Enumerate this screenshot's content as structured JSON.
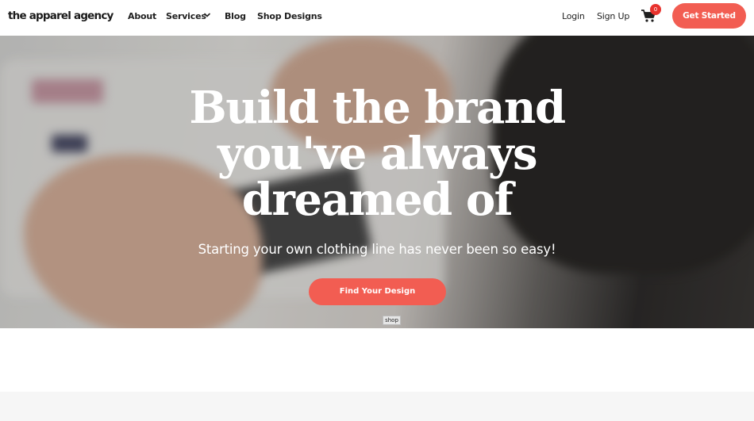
{
  "brand": {
    "logo_text": "the apparel agency"
  },
  "nav": {
    "about": "About",
    "services": "Services",
    "blog": "Blog",
    "shop_designs": "Shop Designs",
    "login": "Login",
    "signup": "Sign Up",
    "cart_count": "0",
    "get_started": "Get Started"
  },
  "hero": {
    "headline_line1": "Build the brand",
    "headline_line2": "you've always",
    "headline_line3": "dreamed of",
    "subheadline": "Starting your own clothing line has never been so easy!",
    "cta_label": "Find Your Design",
    "tag_label": "shop"
  },
  "colors": {
    "accent": "#f25d52",
    "badge": "#e8322d"
  },
  "icons": {
    "cart": "shopping-cart-icon",
    "dropdown": "chevron-down-icon"
  }
}
